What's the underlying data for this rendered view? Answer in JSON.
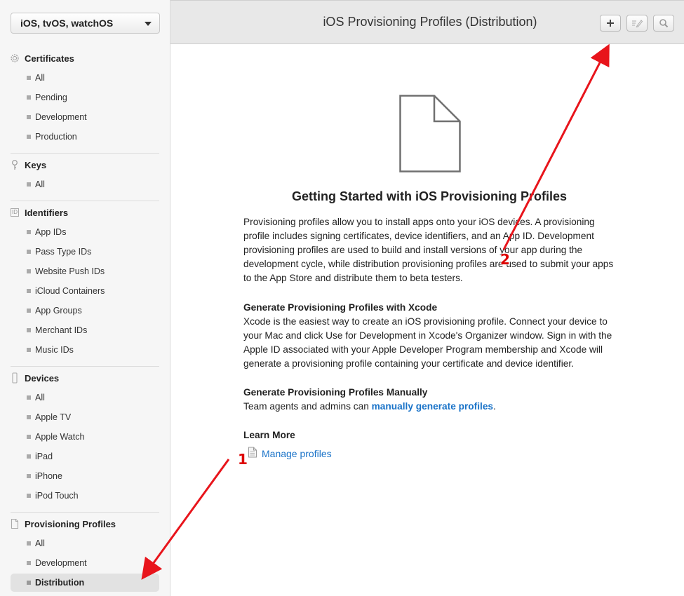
{
  "platform_selector": {
    "label": "iOS, tvOS, watchOS"
  },
  "sidebar": {
    "certificates": {
      "label": "Certificates",
      "items": [
        "All",
        "Pending",
        "Development",
        "Production"
      ]
    },
    "keys": {
      "label": "Keys",
      "items": [
        "All"
      ]
    },
    "identifiers": {
      "label": "Identifiers",
      "icon_text": "ID",
      "items": [
        "App IDs",
        "Pass Type IDs",
        "Website Push IDs",
        "iCloud Containers",
        "App Groups",
        "Merchant IDs",
        "Music IDs"
      ]
    },
    "devices": {
      "label": "Devices",
      "items": [
        "All",
        "Apple TV",
        "Apple Watch",
        "iPad",
        "iPhone",
        "iPod Touch"
      ]
    },
    "provisioning": {
      "label": "Provisioning Profiles",
      "items": [
        "All",
        "Development",
        "Distribution"
      ],
      "selected": "Distribution"
    }
  },
  "header": {
    "title": "iOS Provisioning Profiles (Distribution)"
  },
  "main": {
    "heading": "Getting Started with iOS Provisioning Profiles",
    "intro": "Provisioning profiles allow you to install apps onto your iOS devices. A provisioning profile includes signing certificates, device identifiers, and an App ID. Development provisioning profiles are used to build and install versions of your app during the development cycle, while distribution provisioning profiles are used to submit your apps to the App Store and distribute them to beta testers.",
    "xcode_heading": "Generate Provisioning Profiles with Xcode",
    "xcode_text": "Xcode is the easiest way to create an iOS provisioning profile. Connect your device to your Mac and click Use for Development in Xcode's Organizer window. Sign in with the Apple ID associated with your Apple Developer Program membership and Xcode will generate a provisioning profile containing your certificate and device identifier.",
    "manual_heading": "Generate Provisioning Profiles Manually",
    "manual_text": "Team agents and admins can ",
    "manual_link": "manually generate profiles",
    "manual_suffix": ".",
    "learn_heading": "Learn More",
    "manage_link": "Manage profiles"
  },
  "annotations": {
    "first": "1",
    "second": "2"
  },
  "colors": {
    "arrow": "#e8141b",
    "link": "#1a73c8"
  }
}
